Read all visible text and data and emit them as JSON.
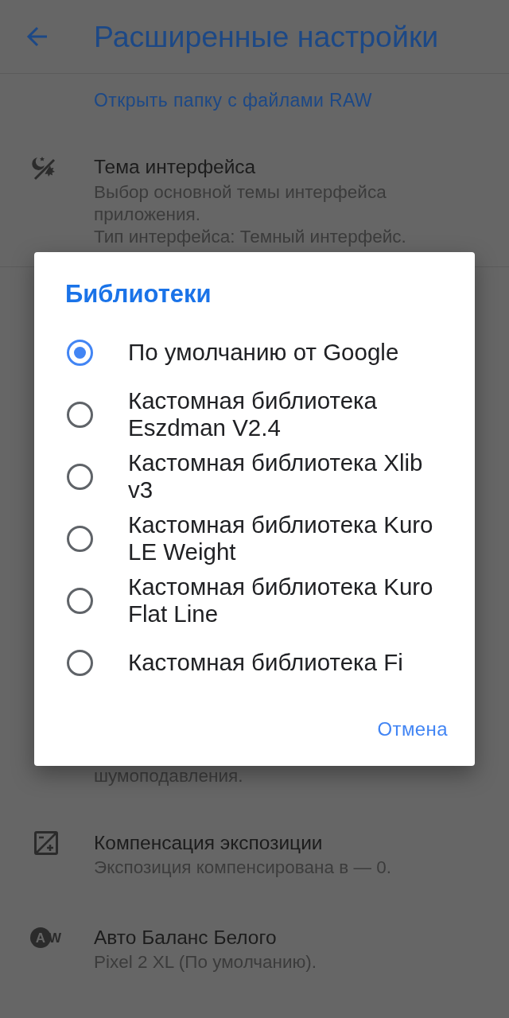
{
  "app_bar": {
    "title": "Расширенные настройки"
  },
  "raw_folder_link": "Открыть папку с файлами RAW",
  "theme_setting": {
    "title": "Тема интерфейса",
    "description": [
      "Выбор основной темы интерфейса приложения.",
      "Тип интерфейса: Темный интерфейс."
    ]
  },
  "covered_setting": {
    "description_end": "шумоподавления."
  },
  "settings": [
    {
      "kind": "exposure",
      "title": "Компенсация экспозиции",
      "description": "Экспозиция компенсирована в — 0."
    },
    {
      "kind": "white_balance",
      "icon_letters": [
        "A",
        "W"
      ],
      "title": "Авто Баланс Белого",
      "description": "Pixel 2 XL (По умолчанию)."
    }
  ],
  "dialog": {
    "title": "Библиотеки",
    "options": [
      {
        "label": "По умолчанию от Google",
        "selected": true
      },
      {
        "label": "Кастомная библиотека Eszdman V2.4",
        "selected": false
      },
      {
        "label": "Кастомная библиотека Xlib v3",
        "selected": false
      },
      {
        "label": "Кастомная библиотека Kuro LE Weight",
        "selected": false
      },
      {
        "label": "Кастомная библиотека Kuro Flat Line",
        "selected": false
      },
      {
        "label": "Кастомная библиотека Fi",
        "selected": false
      }
    ],
    "buttons": [
      "Отмена"
    ]
  }
}
